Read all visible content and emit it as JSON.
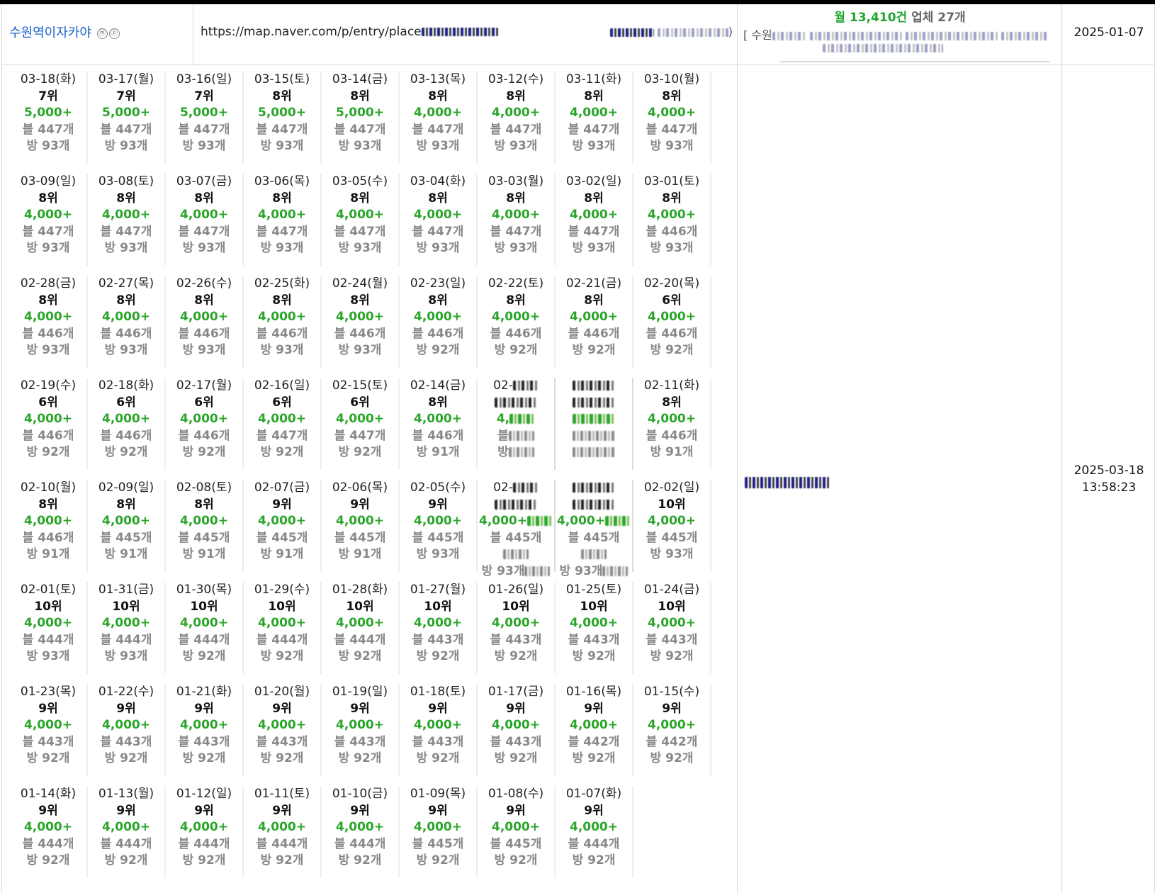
{
  "header": {
    "shop_name": "수원역이자카야",
    "badge_m": "ⓜ",
    "badge_p": "ⓟ",
    "url": "https://map.naver.com/p/entry/place",
    "url_tail_close": ")",
    "monthly_prefix": "월",
    "monthly_count": "13,410건",
    "business_label": "업체 27개",
    "keyword_line_prefix": "[ 수원",
    "registered_date": "2025-01-07"
  },
  "main": {
    "updated_date": "2025-03-18",
    "updated_time": "13:58:23"
  },
  "days": [
    {
      "d": "03-18(화)",
      "r": "7위",
      "v": "5,000+",
      "b": "블 447개",
      "p": "방 93개"
    },
    {
      "d": "03-17(월)",
      "r": "7위",
      "v": "5,000+",
      "b": "블 447개",
      "p": "방 93개"
    },
    {
      "d": "03-16(일)",
      "r": "7위",
      "v": "5,000+",
      "b": "블 447개",
      "p": "방 93개"
    },
    {
      "d": "03-15(토)",
      "r": "8위",
      "v": "5,000+",
      "b": "블 447개",
      "p": "방 93개"
    },
    {
      "d": "03-14(금)",
      "r": "8위",
      "v": "5,000+",
      "b": "블 447개",
      "p": "방 93개"
    },
    {
      "d": "03-13(목)",
      "r": "8위",
      "v": "4,000+",
      "b": "블 447개",
      "p": "방 93개"
    },
    {
      "d": "03-12(수)",
      "r": "8위",
      "v": "4,000+",
      "b": "블 447개",
      "p": "방 93개"
    },
    {
      "d": "03-11(화)",
      "r": "8위",
      "v": "4,000+",
      "b": "블 447개",
      "p": "방 93개"
    },
    {
      "d": "03-10(월)",
      "r": "8위",
      "v": "4,000+",
      "b": "블 447개",
      "p": "방 93개"
    },
    {
      "d": "03-09(일)",
      "r": "8위",
      "v": "4,000+",
      "b": "블 447개",
      "p": "방 93개"
    },
    {
      "d": "03-08(토)",
      "r": "8위",
      "v": "4,000+",
      "b": "블 447개",
      "p": "방 93개"
    },
    {
      "d": "03-07(금)",
      "r": "8위",
      "v": "4,000+",
      "b": "블 447개",
      "p": "방 93개"
    },
    {
      "d": "03-06(목)",
      "r": "8위",
      "v": "4,000+",
      "b": "블 447개",
      "p": "방 93개"
    },
    {
      "d": "03-05(수)",
      "r": "8위",
      "v": "4,000+",
      "b": "블 447개",
      "p": "방 93개"
    },
    {
      "d": "03-04(화)",
      "r": "8위",
      "v": "4,000+",
      "b": "블 447개",
      "p": "방 93개"
    },
    {
      "d": "03-03(월)",
      "r": "8위",
      "v": "4,000+",
      "b": "블 447개",
      "p": "방 93개"
    },
    {
      "d": "03-02(일)",
      "r": "8위",
      "v": "4,000+",
      "b": "블 447개",
      "p": "방 93개"
    },
    {
      "d": "03-01(토)",
      "r": "8위",
      "v": "4,000+",
      "b": "블 446개",
      "p": "방 93개"
    },
    {
      "d": "02-28(금)",
      "r": "8위",
      "v": "4,000+",
      "b": "블 446개",
      "p": "방 93개"
    },
    {
      "d": "02-27(목)",
      "r": "8위",
      "v": "4,000+",
      "b": "블 446개",
      "p": "방 93개"
    },
    {
      "d": "02-26(수)",
      "r": "8위",
      "v": "4,000+",
      "b": "블 446개",
      "p": "방 93개"
    },
    {
      "d": "02-25(화)",
      "r": "8위",
      "v": "4,000+",
      "b": "블 446개",
      "p": "방 93개"
    },
    {
      "d": "02-24(월)",
      "r": "8위",
      "v": "4,000+",
      "b": "블 446개",
      "p": "방 93개"
    },
    {
      "d": "02-23(일)",
      "r": "8위",
      "v": "4,000+",
      "b": "블 446개",
      "p": "방 92개"
    },
    {
      "d": "02-22(토)",
      "r": "8위",
      "v": "4,000+",
      "b": "블 446개",
      "p": "방 92개"
    },
    {
      "d": "02-21(금)",
      "r": "8위",
      "v": "4,000+",
      "b": "블 446개",
      "p": "방 92개"
    },
    {
      "d": "02-20(목)",
      "r": "6위",
      "v": "4,000+",
      "b": "블 446개",
      "p": "방 92개"
    },
    {
      "d": "02-19(수)",
      "r": "6위",
      "v": "4,000+",
      "b": "블 446개",
      "p": "방 92개"
    },
    {
      "d": "02-18(화)",
      "r": "6위",
      "v": "4,000+",
      "b": "블 446개",
      "p": "방 92개"
    },
    {
      "d": "02-17(월)",
      "r": "6위",
      "v": "4,000+",
      "b": "블 446개",
      "p": "방 92개"
    },
    {
      "d": "02-16(일)",
      "r": "6위",
      "v": "4,000+",
      "b": "블 447개",
      "p": "방 92개"
    },
    {
      "d": "02-15(토)",
      "r": "6위",
      "v": "4,000+",
      "b": "블 447개",
      "p": "방 92개"
    },
    {
      "d": "02-14(금)",
      "r": "8위",
      "v": "4,000+",
      "b": "블 446개",
      "p": "방 91개"
    },
    {
      "masked": true,
      "d": "02-",
      "r": "",
      "v": "4,",
      "b": "블",
      "p": "방"
    },
    {
      "masked": true,
      "d": "",
      "r": "",
      "v": "",
      "b": "",
      "p": ""
    },
    {
      "d": "02-11(화)",
      "r": "8위",
      "v": "4,000+",
      "b": "블 446개",
      "p": "방 91개"
    },
    {
      "d": "02-10(월)",
      "r": "8위",
      "v": "4,000+",
      "b": "블 446개",
      "p": "방 91개"
    },
    {
      "d": "02-09(일)",
      "r": "8위",
      "v": "4,000+",
      "b": "블 445개",
      "p": "방 91개"
    },
    {
      "d": "02-08(토)",
      "r": "8위",
      "v": "4,000+",
      "b": "블 445개",
      "p": "방 91개"
    },
    {
      "d": "02-07(금)",
      "r": "9위",
      "v": "4,000+",
      "b": "블 445개",
      "p": "방 91개"
    },
    {
      "d": "02-06(목)",
      "r": "9위",
      "v": "4,000+",
      "b": "블 445개",
      "p": "방 91개"
    },
    {
      "d": "02-05(수)",
      "r": "9위",
      "v": "4,000+",
      "b": "블 445개",
      "p": "방 93개"
    },
    {
      "masked": true,
      "d": "02-",
      "r": "",
      "v": "4,000+",
      "b": "블 445개",
      "p": "방 93개"
    },
    {
      "masked": true,
      "d": "",
      "r": "",
      "v": "4,000+",
      "b": "블 445개",
      "p": "방 93개"
    },
    {
      "d": "02-02(일)",
      "r": "10위",
      "v": "4,000+",
      "b": "블 445개",
      "p": "방 93개"
    },
    {
      "d": "02-01(토)",
      "r": "10위",
      "v": "4,000+",
      "b": "블 444개",
      "p": "방 93개"
    },
    {
      "d": "01-31(금)",
      "r": "10위",
      "v": "4,000+",
      "b": "블 444개",
      "p": "방 93개"
    },
    {
      "d": "01-30(목)",
      "r": "10위",
      "v": "4,000+",
      "b": "블 444개",
      "p": "방 92개"
    },
    {
      "d": "01-29(수)",
      "r": "10위",
      "v": "4,000+",
      "b": "블 444개",
      "p": "방 92개"
    },
    {
      "d": "01-28(화)",
      "r": "10위",
      "v": "4,000+",
      "b": "블 444개",
      "p": "방 92개"
    },
    {
      "d": "01-27(월)",
      "r": "10위",
      "v": "4,000+",
      "b": "블 443개",
      "p": "방 92개"
    },
    {
      "d": "01-26(일)",
      "r": "10위",
      "v": "4,000+",
      "b": "블 443개",
      "p": "방 92개"
    },
    {
      "d": "01-25(토)",
      "r": "10위",
      "v": "4,000+",
      "b": "블 443개",
      "p": "방 92개"
    },
    {
      "d": "01-24(금)",
      "r": "10위",
      "v": "4,000+",
      "b": "블 443개",
      "p": "방 92개"
    },
    {
      "d": "01-23(목)",
      "r": "9위",
      "v": "4,000+",
      "b": "블 443개",
      "p": "방 92개"
    },
    {
      "d": "01-22(수)",
      "r": "9위",
      "v": "4,000+",
      "b": "블 443개",
      "p": "방 92개"
    },
    {
      "d": "01-21(화)",
      "r": "9위",
      "v": "4,000+",
      "b": "블 443개",
      "p": "방 92개"
    },
    {
      "d": "01-20(월)",
      "r": "9위",
      "v": "4,000+",
      "b": "블 443개",
      "p": "방 92개"
    },
    {
      "d": "01-19(일)",
      "r": "9위",
      "v": "4,000+",
      "b": "블 443개",
      "p": "방 92개"
    },
    {
      "d": "01-18(토)",
      "r": "9위",
      "v": "4,000+",
      "b": "블 443개",
      "p": "방 92개"
    },
    {
      "d": "01-17(금)",
      "r": "9위",
      "v": "4,000+",
      "b": "블 443개",
      "p": "방 92개"
    },
    {
      "d": "01-16(목)",
      "r": "9위",
      "v": "4,000+",
      "b": "블 442개",
      "p": "방 92개"
    },
    {
      "d": "01-15(수)",
      "r": "9위",
      "v": "4,000+",
      "b": "블 442개",
      "p": "방 92개"
    },
    {
      "d": "01-14(화)",
      "r": "9위",
      "v": "4,000+",
      "b": "블 444개",
      "p": "방 92개"
    },
    {
      "d": "01-13(월)",
      "r": "9위",
      "v": "4,000+",
      "b": "블 444개",
      "p": "방 92개"
    },
    {
      "d": "01-12(일)",
      "r": "9위",
      "v": "4,000+",
      "b": "블 444개",
      "p": "방 92개"
    },
    {
      "d": "01-11(토)",
      "r": "9위",
      "v": "4,000+",
      "b": "블 444개",
      "p": "방 92개"
    },
    {
      "d": "01-10(금)",
      "r": "9위",
      "v": "4,000+",
      "b": "블 444개",
      "p": "방 92개"
    },
    {
      "d": "01-09(목)",
      "r": "9위",
      "v": "4,000+",
      "b": "블 445개",
      "p": "방 92개"
    },
    {
      "d": "01-08(수)",
      "r": "9위",
      "v": "4,000+",
      "b": "블 445개",
      "p": "방 92개"
    },
    {
      "d": "01-07(화)",
      "r": "9위",
      "v": "4,000+",
      "b": "블 444개",
      "p": "방 92개"
    }
  ]
}
